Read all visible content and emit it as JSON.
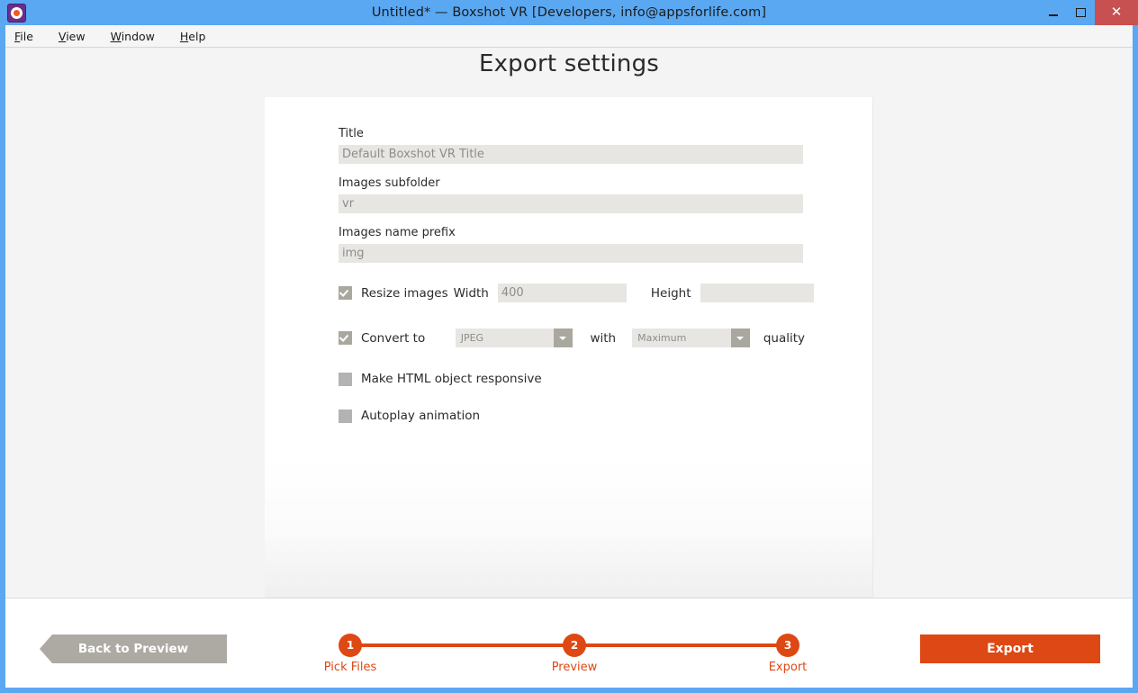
{
  "window": {
    "title": "Untitled* — Boxshot VR [Developers, info@appsforlife.com]",
    "app_icon": "boxshot-vr-icon",
    "controls": {
      "minimize": "minimize-icon",
      "maximize": "maximize-icon",
      "close": "✕"
    },
    "accent_color": "#dd4814",
    "titlebar_color": "#5aa8f2",
    "close_button_color": "#c75050"
  },
  "menubar": {
    "items": [
      {
        "mnemonic": "F",
        "rest": "ile"
      },
      {
        "mnemonic": "V",
        "rest": "iew"
      },
      {
        "mnemonic": "W",
        "rest": "indow"
      },
      {
        "mnemonic": "H",
        "rest": "elp"
      }
    ]
  },
  "page": {
    "title": "Export settings"
  },
  "form": {
    "title_field": {
      "label": "Title",
      "value": "Default Boxshot VR Title"
    },
    "subfolder_field": {
      "label": "Images subfolder",
      "value": "vr"
    },
    "prefix_field": {
      "label": "Images name prefix",
      "value": "img"
    },
    "resize": {
      "label": "Resize images",
      "checked": true,
      "width_label": "Width",
      "width_value": "400",
      "height_label": "Height",
      "height_value": ""
    },
    "convert": {
      "label": "Convert to",
      "checked": true,
      "format_value": "JPEG",
      "with_label": "with",
      "quality_value": "Maximum",
      "quality_label": "quality"
    },
    "responsive": {
      "label": "Make HTML object responsive",
      "checked": false
    },
    "autoplay": {
      "label": "Autoplay animation",
      "checked": false
    }
  },
  "footer": {
    "back_button": "Back to Preview",
    "export_button": "Export",
    "steps": [
      {
        "number": "1",
        "label": "Pick Files"
      },
      {
        "number": "2",
        "label": "Preview"
      },
      {
        "number": "3",
        "label": "Export"
      }
    ]
  }
}
